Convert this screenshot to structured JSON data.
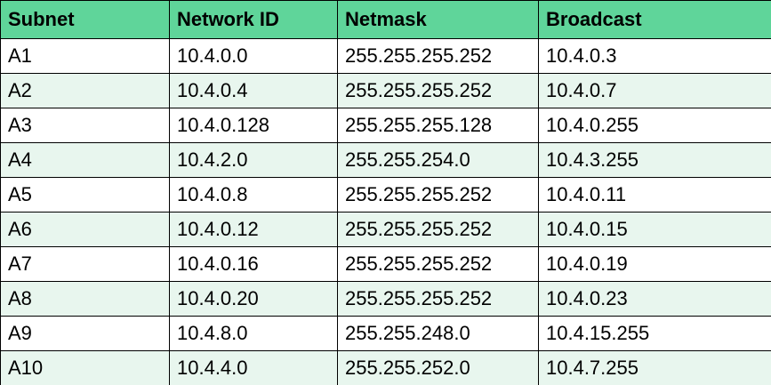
{
  "table": {
    "headers": [
      "Subnet",
      "Network ID",
      "Netmask",
      "Broadcast"
    ],
    "rows": [
      [
        "A1",
        "10.4.0.0",
        "255.255.255.252",
        "10.4.0.3"
      ],
      [
        "A2",
        "10.4.0.4",
        "255.255.255.252",
        "10.4.0.7"
      ],
      [
        "A3",
        "10.4.0.128",
        "255.255.255.128",
        "10.4.0.255"
      ],
      [
        "A4",
        "10.4.2.0",
        "255.255.254.0",
        "10.4.3.255"
      ],
      [
        "A5",
        "10.4.0.8",
        "255.255.255.252",
        "10.4.0.11"
      ],
      [
        "A6",
        "10.4.0.12",
        "255.255.255.252",
        "10.4.0.15"
      ],
      [
        "A7",
        "10.4.0.16",
        "255.255.255.252",
        "10.4.0.19"
      ],
      [
        "A8",
        "10.4.0.20",
        "255.255.255.252",
        "10.4.0.23"
      ],
      [
        "A9",
        "10.4.8.0",
        "255.255.248.0",
        "10.4.15.255"
      ],
      [
        "A10",
        "10.4.4.0",
        "255.255.252.0",
        "10.4.7.255"
      ]
    ]
  },
  "colors": {
    "header_bg": "#5fd59a",
    "stripe_bg": "#e8f6ee",
    "border": "#000000"
  }
}
